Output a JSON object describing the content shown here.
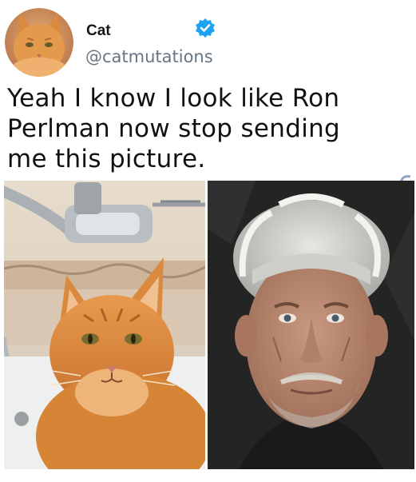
{
  "tweet": {
    "display_name": "Cat",
    "handle": "@catmutations",
    "text_lines": [
      "Yeah I know I look like Ron",
      "Perlman now stop sending",
      "me this picture."
    ]
  },
  "colors": {
    "verified_blue": "#1da1f2",
    "handle_gray": "#657786",
    "text": "#111111"
  },
  "icons": {
    "verified": "verified-badge-icon"
  },
  "media": {
    "left_photo": "orange-cat-in-bathtub",
    "right_photo": "man-with-gray-hair-and-mustache"
  }
}
